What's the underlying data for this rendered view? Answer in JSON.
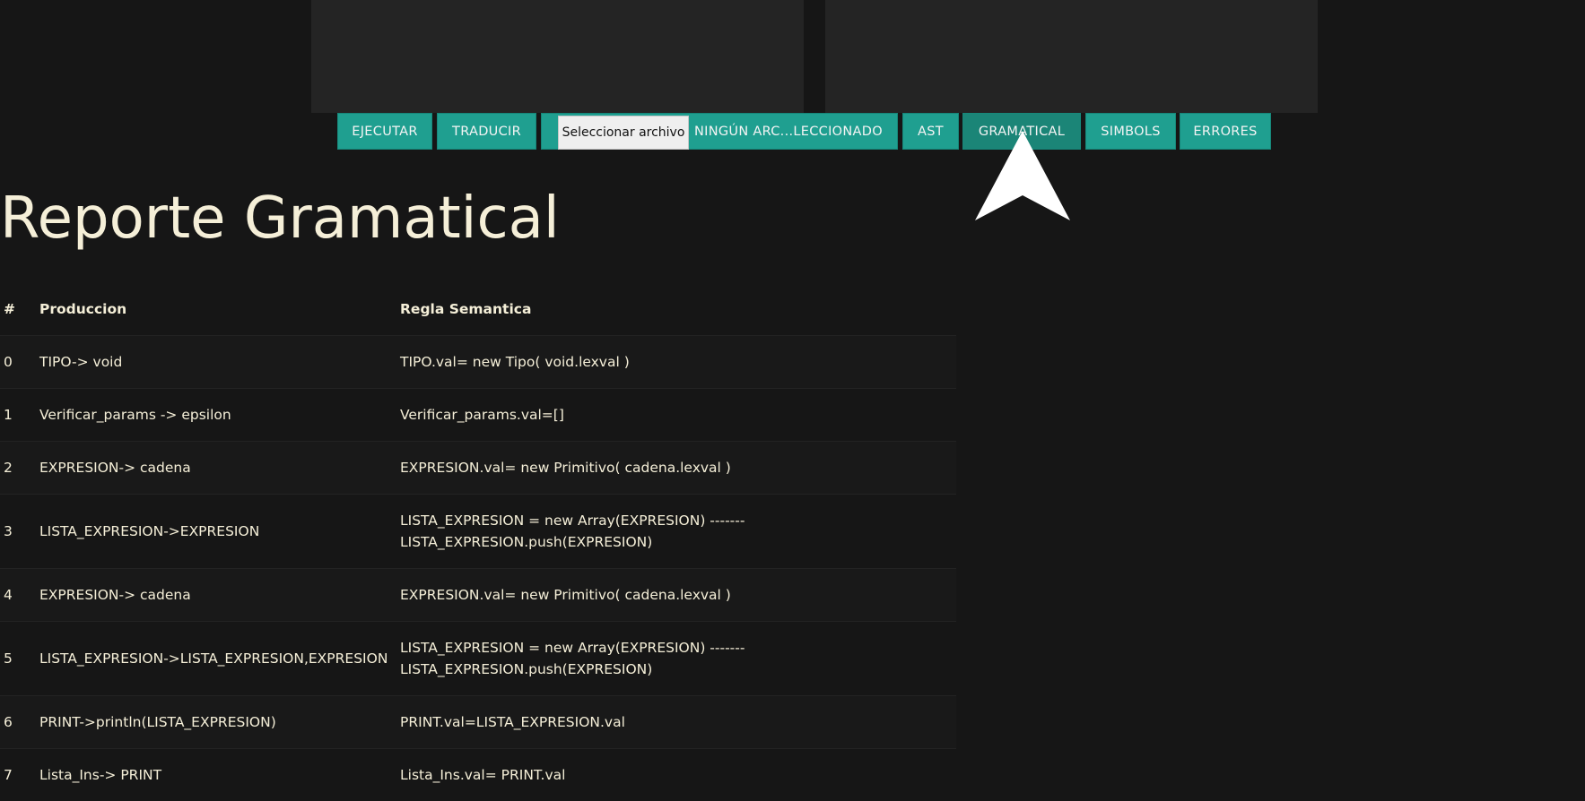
{
  "toolbar": {
    "ejecutar": "EJECUTAR",
    "traducir": "TRADUCIR",
    "file_choose": "Seleccionar archivo",
    "file_status": "NINGÚN ARC...LECCIONADO",
    "ast": "AST",
    "gramatical": "GRAMATICAL",
    "simbols": "SIMBOLS",
    "errores": "ERRORES"
  },
  "report": {
    "title": "Reporte Gramatical",
    "headers": {
      "num": "#",
      "production": "Produccion",
      "rule": "Regla Semantica"
    },
    "rows": [
      {
        "num": "0",
        "production": "TIPO-> void",
        "rule": [
          "TIPO.val= new Tipo( void.lexval )"
        ]
      },
      {
        "num": "1",
        "production": "Verificar_params -> epsilon",
        "rule": [
          "Verificar_params.val=[]"
        ]
      },
      {
        "num": "2",
        "production": "EXPRESION-> cadena",
        "rule": [
          "EXPRESION.val= new Primitivo( cadena.lexval )"
        ]
      },
      {
        "num": "3",
        "production": "LISTA_EXPRESION->EXPRESION",
        "rule": [
          "LISTA_EXPRESION = new Array(EXPRESION) -------",
          "LISTA_EXPRESION.push(EXPRESION)"
        ]
      },
      {
        "num": "4",
        "production": "EXPRESION-> cadena",
        "rule": [
          "EXPRESION.val= new Primitivo( cadena.lexval )"
        ]
      },
      {
        "num": "5",
        "production": "LISTA_EXPRESION->LISTA_EXPRESION,EXPRESION",
        "rule": [
          "LISTA_EXPRESION = new Array(EXPRESION) -------",
          "LISTA_EXPRESION.push(EXPRESION)"
        ]
      },
      {
        "num": "6",
        "production": "PRINT->println(LISTA_EXPRESION)",
        "rule": [
          "PRINT.val=LISTA_EXPRESION.val"
        ]
      },
      {
        "num": "7",
        "production": "Lista_Ins-> PRINT",
        "rule": [
          "Lista_Ins.val= PRINT.val"
        ]
      }
    ]
  },
  "colors": {
    "background": "#161616",
    "panel": "#242424",
    "button": "#1f9f90",
    "button_active": "#1b8577",
    "text": "#f5efd8"
  },
  "icons": {
    "cursor": "mouse-pointer-icon"
  }
}
